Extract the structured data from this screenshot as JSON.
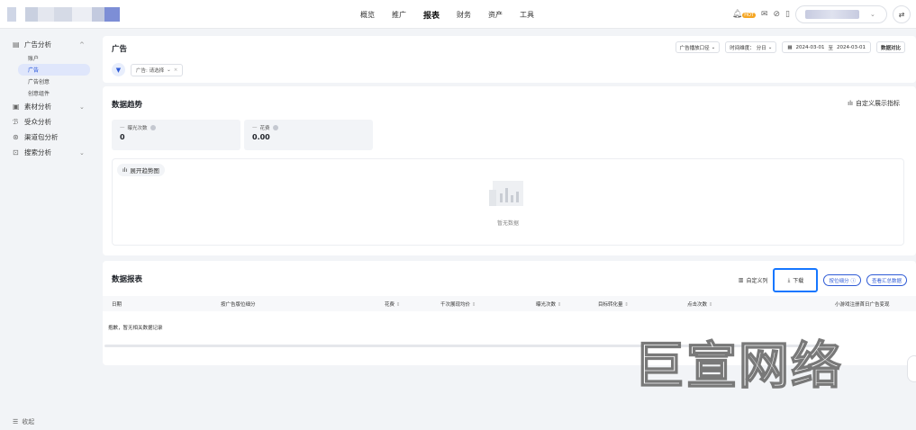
{
  "header": {
    "nav": [
      "概览",
      "推广",
      "报表",
      "财务",
      "资产",
      "工具"
    ],
    "active_nav": "报表",
    "hot_badge": "HOT",
    "swap_icon": "⇄"
  },
  "sidebar": {
    "groups": [
      {
        "label": "广告分析",
        "icon": "chart-icon",
        "expanded": true,
        "subs": [
          "账户",
          "广告",
          "广告创意",
          "创意组件"
        ],
        "active_sub": "广告"
      },
      {
        "label": "素材分析",
        "icon": "image-icon",
        "expanded": false
      },
      {
        "label": "受众分析",
        "icon": "users-icon"
      },
      {
        "label": "渠道包分析",
        "icon": "package-icon"
      },
      {
        "label": "搜索分析",
        "icon": "search-icon",
        "expanded": false
      }
    ],
    "collapse_label": "收起"
  },
  "ad_panel": {
    "title": "广告",
    "placement_select": "广告播放口径",
    "time_dim_label": "时间维度：",
    "time_dim_value": "分日",
    "date_start": "2024-03-01",
    "date_sep": "至",
    "date_end": "2024-03-01",
    "compare_label": "数据对比",
    "filter_chip": "广告: 请选择"
  },
  "trend_panel": {
    "title": "数据趋势",
    "custom_metric": "自定义展示指标",
    "metrics": [
      {
        "label": "曝光次数",
        "value": "0"
      },
      {
        "label": "花费",
        "value": "0.00"
      }
    ],
    "expand_label": "展开趋势图",
    "empty_text": "暂无数据"
  },
  "report_panel": {
    "title": "数据报表",
    "custom_cols": "自定义列",
    "download": "下载",
    "slot_breakdown": "按位细分",
    "view_summary": "查看汇总数据",
    "columns": [
      "日期",
      "按广告版位细分",
      "花费",
      "千次展现均价",
      "曝光次数",
      "目标转化量",
      "点击次数",
      "小游戏注册首日广告变现"
    ],
    "empty_row": "抱歉，暂无相关数据记录"
  },
  "watermark": "巨宣网络"
}
